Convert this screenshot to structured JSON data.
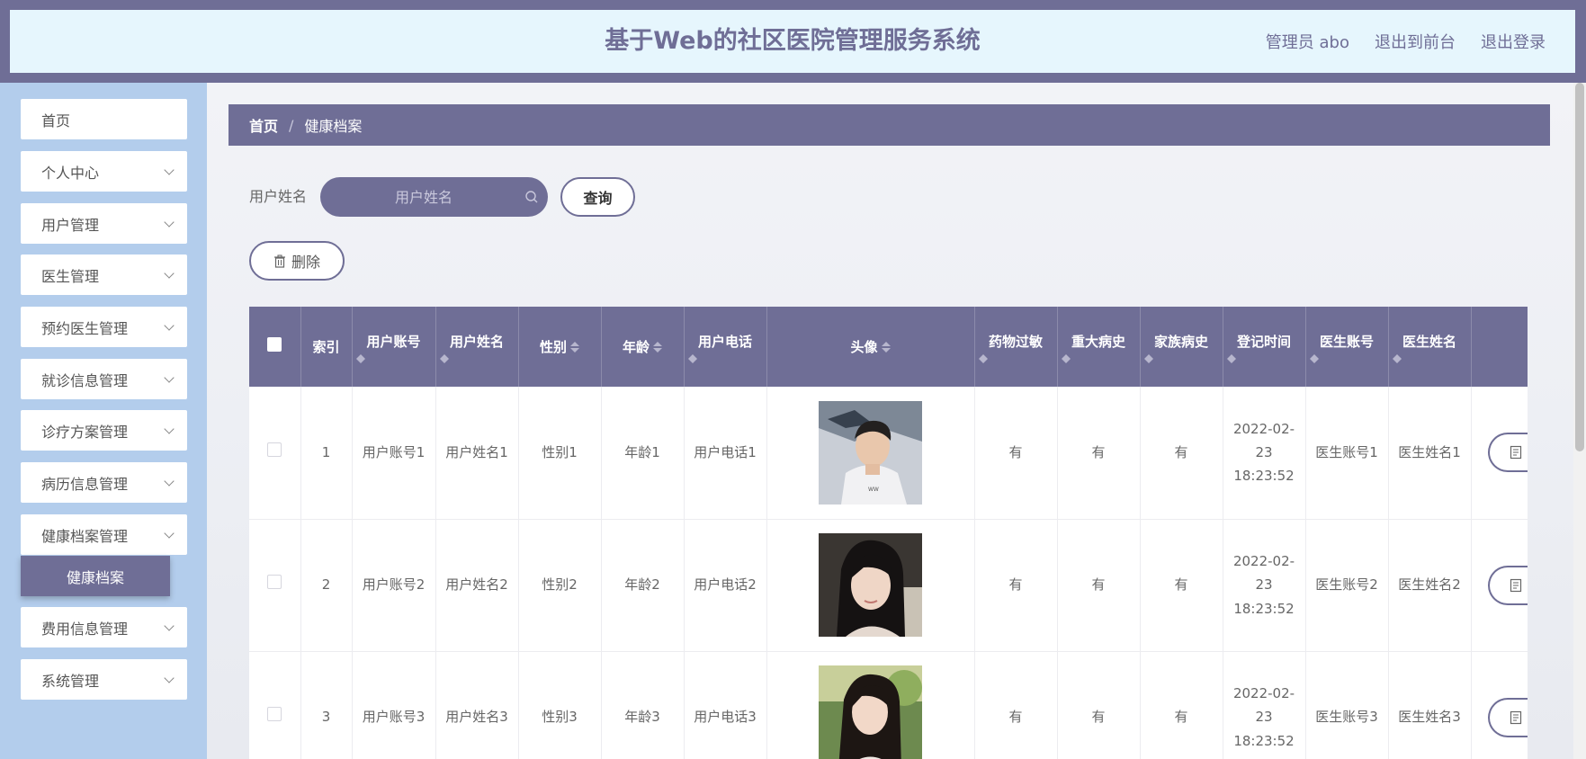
{
  "header": {
    "title": "基于Web的社区医院管理服务系统",
    "admin_label": "管理员 abo",
    "back_to_front": "退出到前台",
    "logout": "退出登录"
  },
  "sidebar": {
    "items": [
      {
        "label": "首页",
        "has_arrow": false
      },
      {
        "label": "个人中心",
        "has_arrow": true
      },
      {
        "label": "用户管理",
        "has_arrow": true
      },
      {
        "label": "医生管理",
        "has_arrow": true
      },
      {
        "label": "预约医生管理",
        "has_arrow": true
      },
      {
        "label": "就诊信息管理",
        "has_arrow": true
      },
      {
        "label": "诊疗方案管理",
        "has_arrow": true
      },
      {
        "label": "病历信息管理",
        "has_arrow": true
      },
      {
        "label": "健康档案管理",
        "has_arrow": true
      },
      {
        "label": "费用信息管理",
        "has_arrow": true
      },
      {
        "label": "系统管理",
        "has_arrow": true
      }
    ],
    "active_sub": "健康档案"
  },
  "breadcrumb": {
    "home": "首页",
    "separator": "/",
    "current": "健康档案"
  },
  "search": {
    "label": "用户姓名",
    "placeholder": "用户姓名",
    "value": "",
    "query_button": "查询",
    "delete_button": "删除"
  },
  "table": {
    "headers": {
      "index": "索引",
      "account": "用户账号",
      "name": "用户姓名",
      "gender": "性别",
      "age": "年龄",
      "phone": "用户电话",
      "avatar": "头像",
      "allergy": "药物过敏",
      "major_history": "重大病史",
      "family_history": "家族病史",
      "register_time": "登记时间",
      "doctor_account": "医生账号",
      "doctor_name": "医生姓名"
    },
    "rows": [
      {
        "index": "1",
        "account": "用户账号1",
        "name": "用户姓名1",
        "gender": "性别1",
        "age": "年龄1",
        "phone": "用户电话1",
        "avatar": "portrait-man-white-shirt",
        "allergy": "有",
        "major_history": "有",
        "family_history": "有",
        "register_time": "2022-02-23 18:23:52",
        "doctor_account": "医生账号1",
        "doctor_name": "医生姓名1"
      },
      {
        "index": "2",
        "account": "用户账号2",
        "name": "用户姓名2",
        "gender": "性别2",
        "age": "年龄2",
        "phone": "用户电话2",
        "avatar": "portrait-woman-dark-hair",
        "allergy": "有",
        "major_history": "有",
        "family_history": "有",
        "register_time": "2022-02-23 18:23:52",
        "doctor_account": "医生账号2",
        "doctor_name": "医生姓名2"
      },
      {
        "index": "3",
        "account": "用户账号3",
        "name": "用户姓名3",
        "gender": "性别3",
        "age": "年龄3",
        "phone": "用户电话3",
        "avatar": "portrait-woman-outdoor",
        "allergy": "有",
        "major_history": "有",
        "family_history": "有",
        "register_time": "2022-02-23 18:23:52",
        "doctor_account": "医生账号3",
        "doctor_name": "医生姓名3"
      }
    ]
  },
  "colors": {
    "primary": "#6f6e96",
    "header_bg": "#e6f6fd",
    "sidebar_bg": "#b3cdec"
  }
}
